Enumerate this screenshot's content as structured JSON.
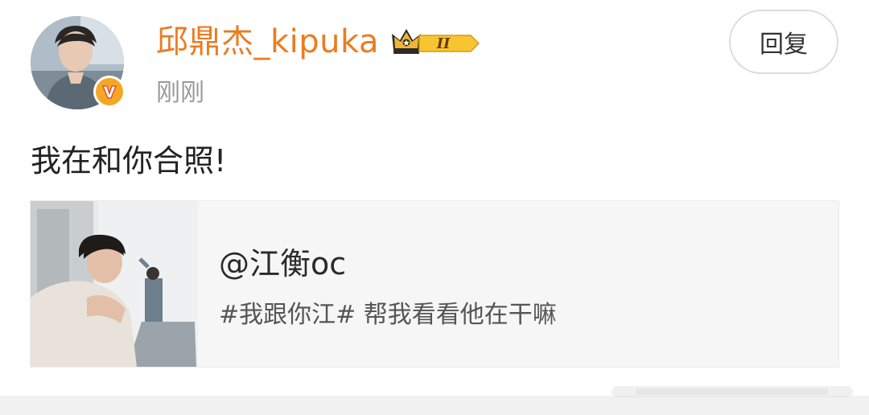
{
  "post": {
    "username": "邱鼎杰_kipuka",
    "timestamp": "刚刚",
    "reply_label": "回复",
    "text": "我在和你合照!",
    "badge": {
      "rank_label": "II",
      "verified_color": "#f5a623",
      "crown_icon": "crown-icon"
    }
  },
  "repost_card": {
    "title": "@江衡oc",
    "description": "#我跟你江# 帮我看看他在干嘛"
  },
  "colors": {
    "username": "#eb7c22",
    "timestamp": "#9a9a9a",
    "card_bg": "#f6f6f6"
  }
}
